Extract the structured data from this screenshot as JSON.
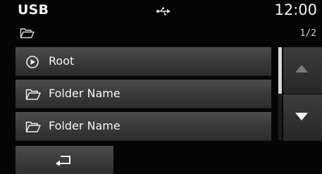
{
  "status_bar": {
    "source": "USB",
    "connection_icon": "usb-icon",
    "time": "12:00"
  },
  "path_bar": {
    "folder_icon": "folder-open-icon",
    "page": "1/2"
  },
  "list": {
    "items": [
      {
        "icon": "play-circle-icon",
        "label": "Root"
      },
      {
        "icon": "folder-open-icon",
        "label": "Folder Name"
      },
      {
        "icon": "folder-open-icon",
        "label": "Folder Name"
      }
    ]
  },
  "scroll": {
    "up_icon": "triangle-up-icon",
    "up_enabled": false,
    "down_icon": "triangle-down-icon",
    "down_enabled": true,
    "position_fraction": 0.5
  },
  "bottom_bar": {
    "back_icon": "back-arrow-icon"
  },
  "colors": {
    "background": "#050505",
    "item_top": "#4e4e4e",
    "item_bottom": "#2d2d2d",
    "text": "#f2f2f2",
    "disabled_arrow": "#7a7a7a"
  }
}
